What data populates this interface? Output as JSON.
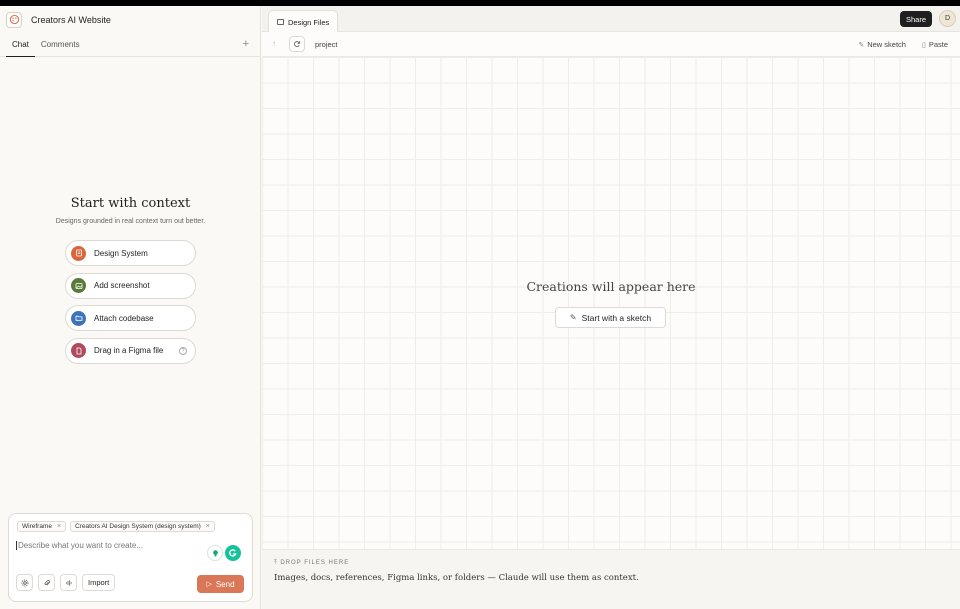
{
  "project": {
    "title": "Creators AI Website"
  },
  "tabs": [
    {
      "label": "Chat"
    },
    {
      "label": "Comments"
    }
  ],
  "context": {
    "title": "Start with context",
    "subtitle": "Designs grounded in real context turn out better.",
    "items": [
      {
        "label": "Design System",
        "color": "#d9653d"
      },
      {
        "label": "Add screenshot",
        "color": "#5a7a3a"
      },
      {
        "label": "Attach codebase",
        "color": "#3d73b8"
      },
      {
        "label": "Drag in a Figma file",
        "color": "#b04a5e"
      }
    ]
  },
  "composer": {
    "chips": [
      {
        "label": "Wireframe"
      },
      {
        "label": "Creators AI Design System (design system)"
      }
    ],
    "placeholder": "Describe what you want to create...",
    "import_label": "Import",
    "send_label": "Send"
  },
  "files": {
    "tab_label": "Design Files",
    "share_label": "Share",
    "avatar_initial": "D",
    "breadcrumb": "project",
    "new_sketch_label": "New sketch",
    "paste_label": "Paste"
  },
  "canvas": {
    "empty_title": "Creations will appear here",
    "sketch_label": "Start with a sketch"
  },
  "dropzone": {
    "heading": "DROP FILES HERE",
    "text": "Images, docs, references, Figma links, or folders — Claude will use them as context."
  },
  "colors": {
    "accent": "#d97757",
    "dark": "#1f1f1f"
  }
}
